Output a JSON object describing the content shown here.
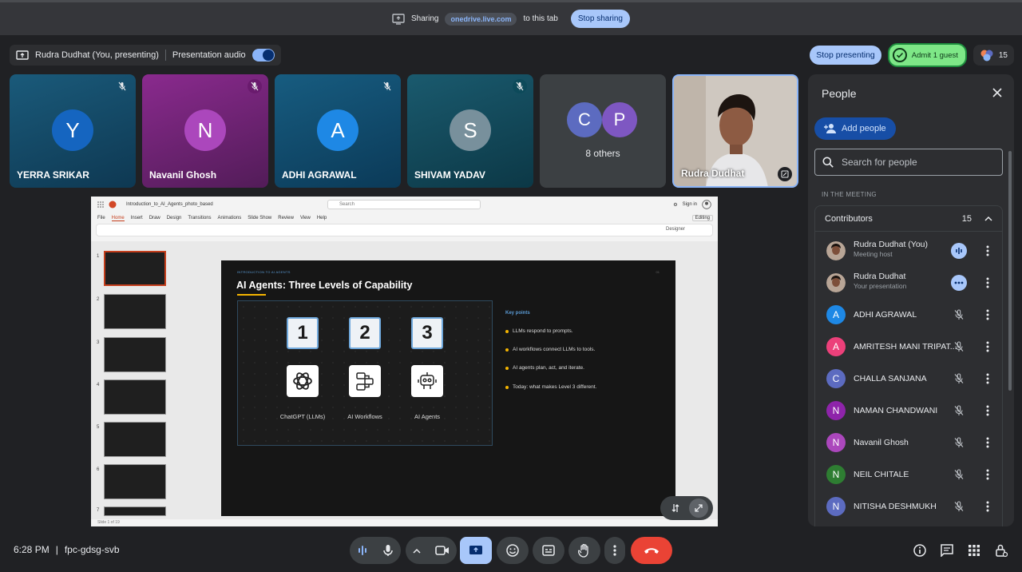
{
  "share_bar": {
    "sharing_label": "Sharing",
    "domain": "onedrive.live.com",
    "suffix": "to this tab",
    "stop_sharing": "Stop sharing"
  },
  "presenting_bar": {
    "presenter": "Rudra Dudhat (You, presenting)",
    "audio_label": "Presentation audio",
    "stop_presenting": "Stop presenting",
    "admit": "Admit 1 guest",
    "people_count": "15"
  },
  "tiles": [
    {
      "initial": "Y",
      "name": "YERRA SRIKAR",
      "color": "#1565c0"
    },
    {
      "initial": "N",
      "name": "Navanil Ghosh",
      "color": "#ab47bc"
    },
    {
      "initial": "A",
      "name": "ADHI AGRAWAL",
      "color": "#1e88e5"
    },
    {
      "initial": "S",
      "name": "SHIVAM YADAV",
      "color": "#78909c"
    },
    {
      "others": "8 others",
      "a": "C",
      "b": "P",
      "color_a": "#5c6bc0",
      "color_b": "#7e57c2"
    },
    {
      "name": "Rudra Dudhat"
    }
  ],
  "ppt": {
    "file_title": "Introduction_to_AI_Agents_photo_based",
    "search": "Search",
    "sign_in": "Sign in",
    "menu": [
      "File",
      "Home",
      "Insert",
      "Draw",
      "Design",
      "Transitions",
      "Animations",
      "Slide Show",
      "Review",
      "View",
      "Help"
    ],
    "ribbon_editing": "Editing",
    "ribbon_designer": "Designer",
    "thumb_numbers": [
      "1",
      "2",
      "3",
      "4",
      "5",
      "6",
      "7"
    ],
    "status": "Slide 1 of 19",
    "slide": {
      "kicker": "INTRODUCTION TO AI AGENTS",
      "page": "01",
      "title": "AI Agents: Three Levels of Capability",
      "levels": [
        {
          "num": "1",
          "label": "ChatGPT (LLMs)",
          "icon": "openai-icon"
        },
        {
          "num": "2",
          "label": "AI Workflows",
          "icon": "workflow-icon"
        },
        {
          "num": "3",
          "label": "AI Agents",
          "icon": "robot-icon"
        }
      ],
      "key_points_title": "Key points",
      "key_points": [
        "LLMs respond to prompts.",
        "AI workflows connect LLMs to tools.",
        "AI agents plan, act, and iterate.",
        "Today: what makes Level 3 different."
      ]
    }
  },
  "people": {
    "title": "People",
    "add_people": "Add people",
    "search_placeholder": "Search for people",
    "in_meeting": "IN THE MEETING",
    "contributors_label": "Contributors",
    "contributors_count": "15",
    "list": [
      {
        "name": "Rudra Dudhat (You)",
        "sub": "Meeting host",
        "avatar": "photo",
        "status": "speaking"
      },
      {
        "name": "Rudra Dudhat",
        "sub": "Your presentation",
        "avatar": "photo",
        "status": "more"
      },
      {
        "name": "ADHI AGRAWAL",
        "initial": "A",
        "color": "#1e88e5",
        "status": "muted"
      },
      {
        "name": "AMRITESH MANI TRIPAT...",
        "initial": "A",
        "color": "#ec407a",
        "status": "muted"
      },
      {
        "name": "CHALLA SANJANA",
        "initial": "C",
        "color": "#5c6bc0",
        "status": "muted"
      },
      {
        "name": "NAMAN CHANDWANI",
        "initial": "N",
        "color": "#8e24aa",
        "status": "muted"
      },
      {
        "name": "Navanil Ghosh",
        "initial": "N",
        "color": "#ab47bc",
        "status": "muted"
      },
      {
        "name": "NEIL CHITALE",
        "initial": "N",
        "color": "#2e7d32",
        "status": "muted"
      },
      {
        "name": "NITISHA DESHMUKH",
        "initial": "N",
        "color": "#5c6bc0",
        "status": "muted"
      }
    ]
  },
  "bottom": {
    "time": "6:28 PM",
    "separator": "|",
    "meeting_code": "fpc-gdsg-svb"
  },
  "colors": {
    "end_call": "#ea4335",
    "present_active": "#a8c7fa",
    "accent_yellow": "#f4b400"
  }
}
